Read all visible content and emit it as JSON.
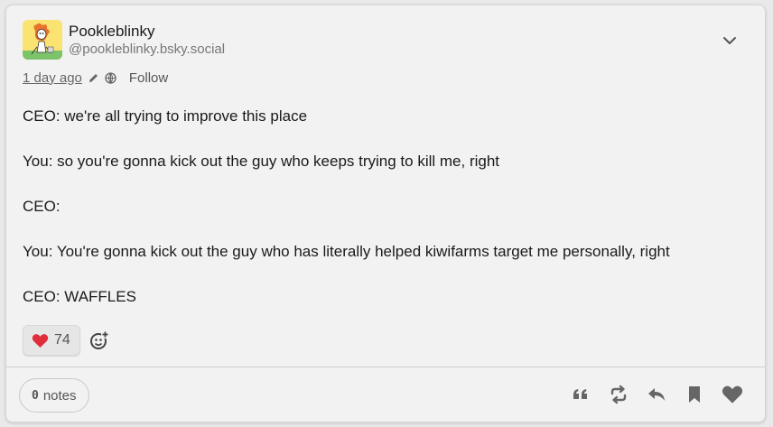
{
  "post": {
    "author": {
      "display_name": "Pookleblinky",
      "handle": "@pookleblinky.bsky.social",
      "avatar_icon": "cartoon-avatar",
      "avatar_bg": "#fbe372"
    },
    "timestamp": "1 day ago",
    "edited_icon": "pencil-icon",
    "visibility_icon": "globe-icon",
    "follow_label": "Follow",
    "paragraphs": [
      "CEO: we're all trying to improve this place",
      "You: so you're gonna kick out the guy who keeps trying to kill me, right",
      "CEO:",
      "You: You're gonna kick out the guy who has literally helped kiwifarms target me personally, right",
      "CEO: WAFFLES"
    ],
    "reactions": [
      {
        "emoji": "heart",
        "color": "#e02d3c",
        "count": "74"
      }
    ],
    "add_reaction_icon": "add-reaction-icon",
    "notes_count": "0",
    "notes_label": "notes",
    "actions": [
      "quote-icon",
      "reblog-icon",
      "reply-icon",
      "bookmark-icon",
      "like-icon"
    ],
    "action_color": "#666666"
  }
}
